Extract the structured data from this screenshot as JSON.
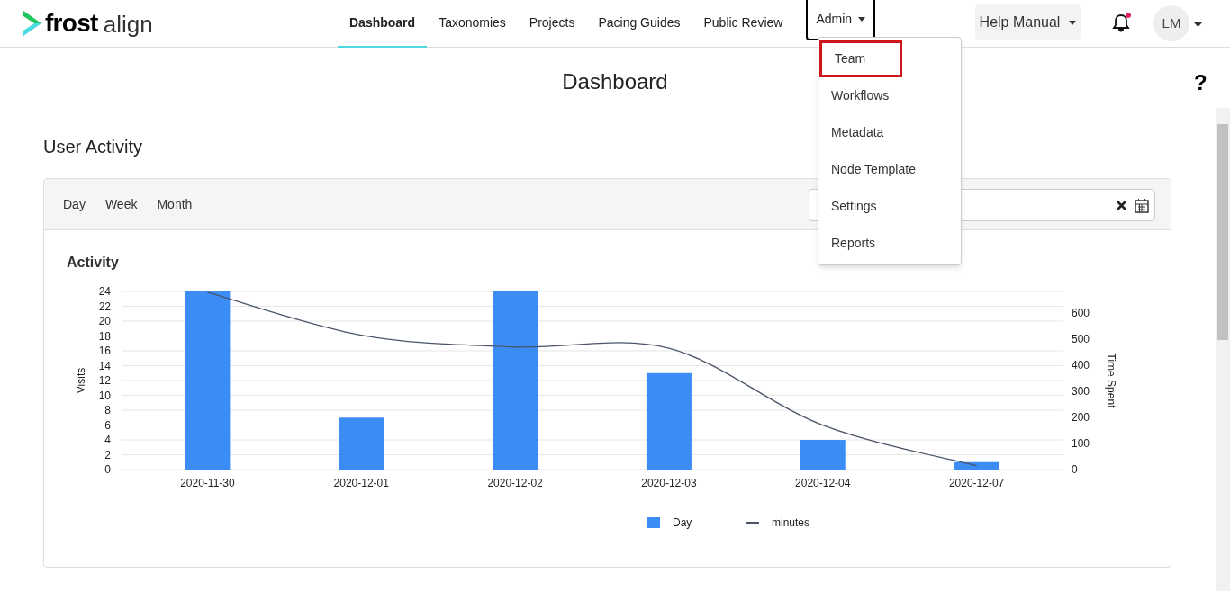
{
  "logo": {
    "brand": "frost",
    "product": "align"
  },
  "nav": [
    {
      "label": "Dashboard",
      "selected": true,
      "kind": "link"
    },
    {
      "label": "Taxonomies",
      "selected": false,
      "kind": "link"
    },
    {
      "label": "Projects",
      "selected": false,
      "kind": "link"
    },
    {
      "label": "Pacing Guides",
      "selected": false,
      "kind": "link"
    },
    {
      "label": "Public Review",
      "selected": false,
      "kind": "link"
    },
    {
      "label": "Admin",
      "selected": false,
      "kind": "dropdown",
      "expanded": true
    }
  ],
  "admin_menu": [
    {
      "label": "Team",
      "highlighted": true
    },
    {
      "label": "Workflows",
      "highlighted": false
    },
    {
      "label": "Metadata",
      "highlighted": false
    },
    {
      "label": "Node Template",
      "highlighted": false
    },
    {
      "label": "Settings",
      "highlighted": false
    },
    {
      "label": "Reports",
      "highlighted": false
    }
  ],
  "help_button": {
    "label": "Help Manual"
  },
  "notifications": {
    "unread": true
  },
  "user": {
    "initials": "LM"
  },
  "page_title": "Dashboard",
  "help_icon": "?",
  "section_title": "User Activity",
  "period_tabs": [
    "Day",
    "Week",
    "Month"
  ],
  "chart_panel": {
    "title": "Activity",
    "chart_data": {
      "type": "bar",
      "ylabel": "Visits",
      "y2label": "Time Spent",
      "categories": [
        "2020-11-30",
        "2020-12-01",
        "2020-12-02",
        "2020-12-03",
        "2020-12-04",
        "2020-12-07"
      ],
      "grid": true,
      "legend": true,
      "series": [
        {
          "name": "Day",
          "color": "#3b8cf5",
          "values": [
            24,
            7,
            24,
            13,
            4,
            1
          ]
        },
        {
          "name": "minutes",
          "color": "#4a5568",
          "type": "line",
          "axis": "y2",
          "values": [
            680,
            515,
            470,
            465,
            170,
            15
          ]
        }
      ],
      "ylim": [
        0,
        24
      ],
      "yticks": [
        0,
        2,
        4,
        6,
        8,
        10,
        12,
        14,
        16,
        18,
        20,
        22,
        24
      ],
      "y2lim": [
        0,
        683
      ],
      "y2ticks": [
        0,
        100,
        200,
        300,
        400,
        500,
        600
      ]
    }
  }
}
